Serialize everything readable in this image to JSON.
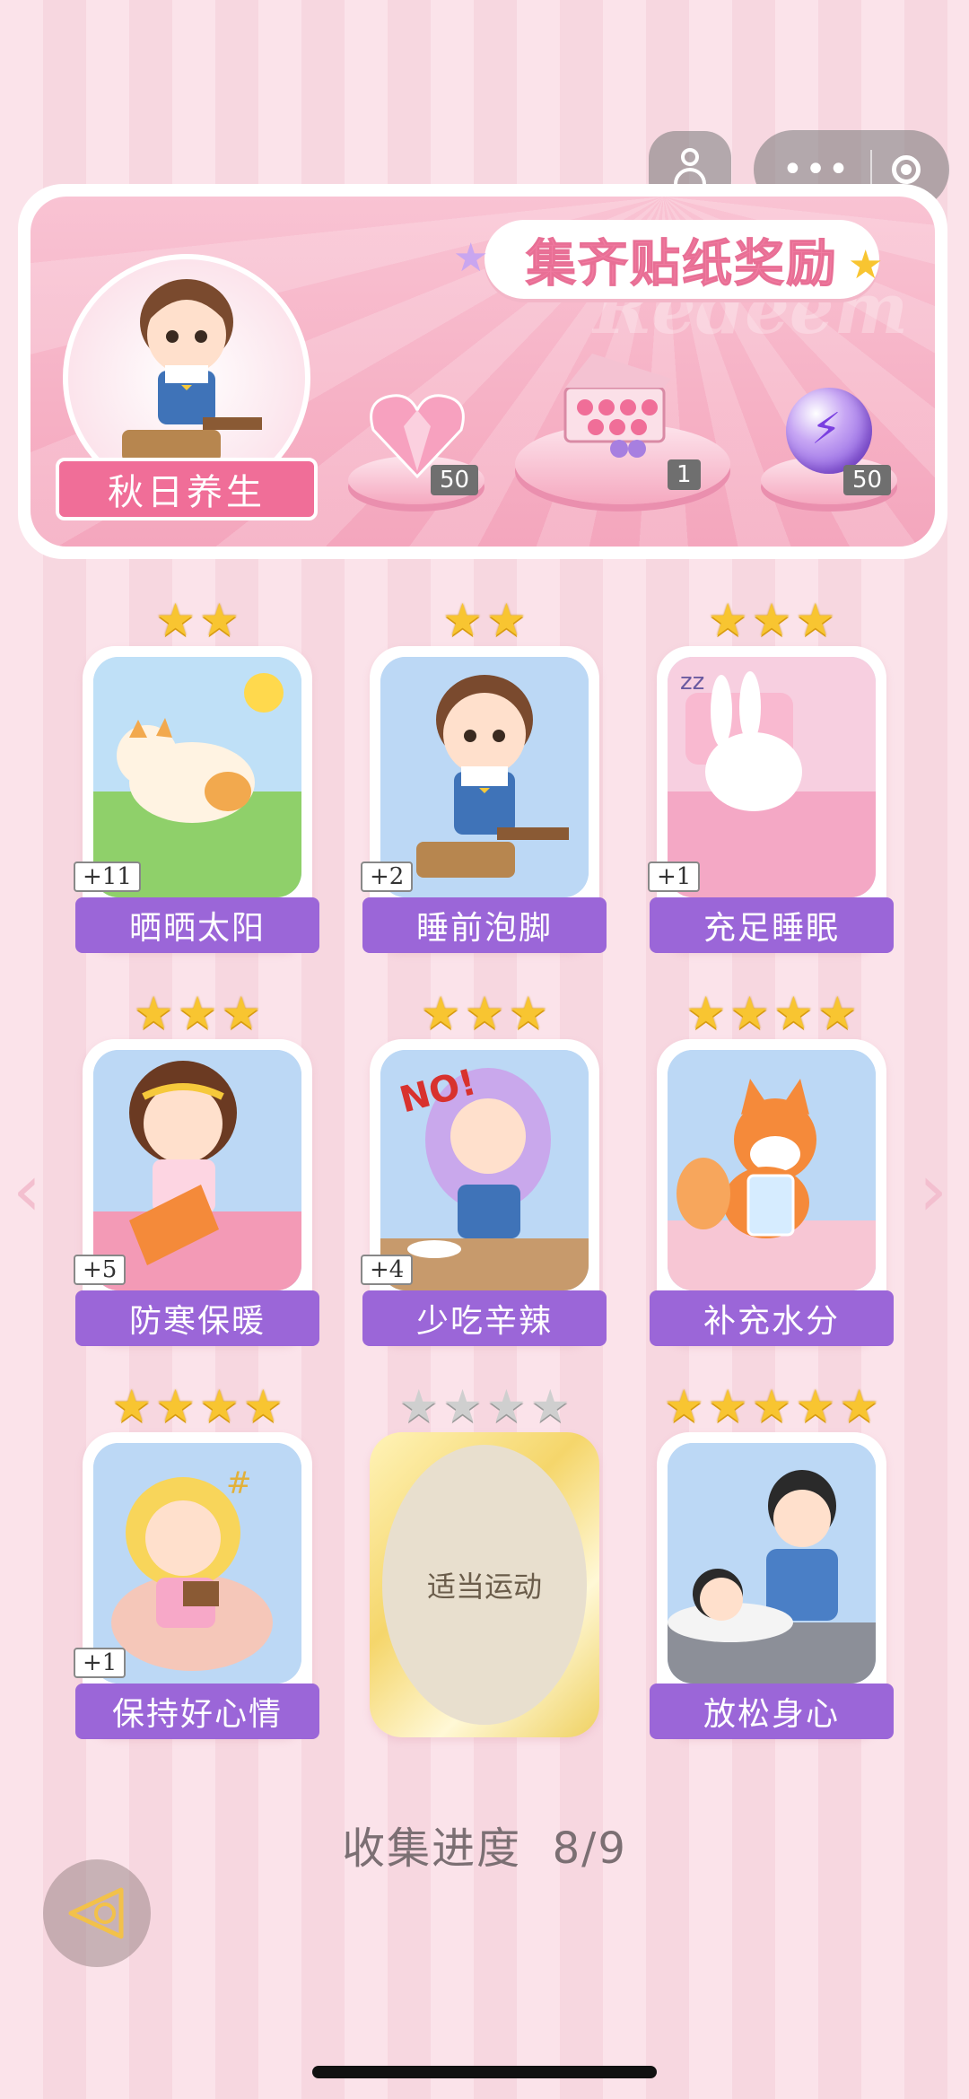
{
  "header": {
    "title": "集齐贴纸奖励",
    "watermark": "Redeem",
    "theme_label": "秋日养生"
  },
  "rewards": [
    {
      "name": "heart-gem",
      "count": "50"
    },
    {
      "name": "gift-box",
      "count": "1"
    },
    {
      "name": "energy-orb",
      "count": "50"
    }
  ],
  "cards": [
    {
      "label": "晒晒太阳",
      "count": "+11",
      "stars": 2,
      "collected": true
    },
    {
      "label": "睡前泡脚",
      "count": "+2",
      "stars": 2,
      "collected": true
    },
    {
      "label": "充足睡眠",
      "count": "+1",
      "stars": 3,
      "collected": true
    },
    {
      "label": "防寒保暖",
      "count": "+5",
      "stars": 3,
      "collected": true
    },
    {
      "label": "少吃辛辣",
      "count": "+4",
      "stars": 3,
      "collected": true
    },
    {
      "label": "补充水分",
      "count": "",
      "stars": 4,
      "collected": true
    },
    {
      "label": "保持好心情",
      "count": "+1",
      "stars": 4,
      "collected": true
    },
    {
      "label": "适当运动",
      "count": "",
      "stars": 4,
      "collected": false
    },
    {
      "label": "放松身心",
      "count": "",
      "stars": 5,
      "collected": true
    }
  ],
  "progress": {
    "label": "收集进度",
    "value": "8/9"
  },
  "colors": {
    "accent": "#f06e98",
    "label_purple": "#9b66d8",
    "star_gold": "#f8c531"
  }
}
